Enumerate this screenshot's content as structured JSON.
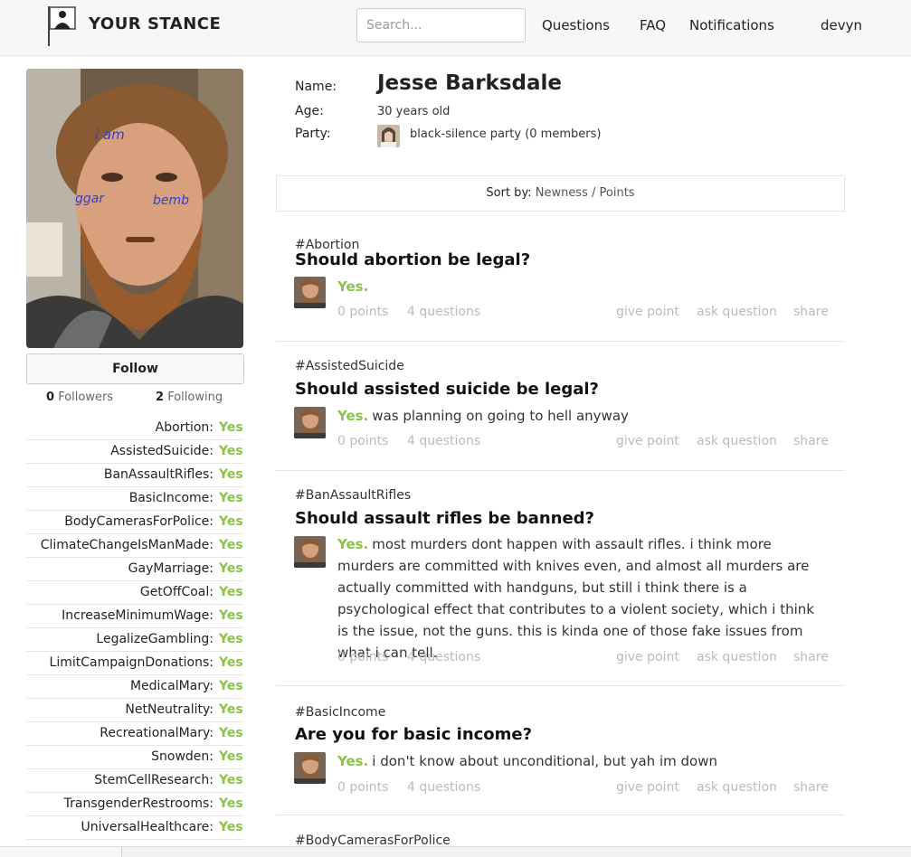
{
  "header": {
    "logo_text": "YOUR STANCE",
    "search_placeholder": "Search...",
    "nav": [
      "Questions",
      "FAQ",
      "Notifications",
      "devyn"
    ]
  },
  "sidebar": {
    "follow_label": "Follow",
    "followers_count": "0",
    "followers_label": "Followers",
    "following_count": "2",
    "following_label": "Following",
    "stances": [
      {
        "topic": "Abortion:",
        "value": "Yes"
      },
      {
        "topic": "AssistedSuicide:",
        "value": "Yes"
      },
      {
        "topic": "BanAssaultRifles:",
        "value": "Yes"
      },
      {
        "topic": "BasicIncome:",
        "value": "Yes"
      },
      {
        "topic": "BodyCamerasForPolice:",
        "value": "Yes"
      },
      {
        "topic": "ClimateChangeIsManMade:",
        "value": "Yes"
      },
      {
        "topic": "GayMarriage:",
        "value": "Yes"
      },
      {
        "topic": "GetOffCoal:",
        "value": "Yes"
      },
      {
        "topic": "IncreaseMinimumWage:",
        "value": "Yes"
      },
      {
        "topic": "LegalizeGambling:",
        "value": "Yes"
      },
      {
        "topic": "LimitCampaignDonations:",
        "value": "Yes"
      },
      {
        "topic": "MedicalMary:",
        "value": "Yes"
      },
      {
        "topic": "NetNeutrality:",
        "value": "Yes"
      },
      {
        "topic": "RecreationalMary:",
        "value": "Yes"
      },
      {
        "topic": "Snowden:",
        "value": "Yes"
      },
      {
        "topic": "StemCellResearch:",
        "value": "Yes"
      },
      {
        "topic": "TransgenderRestrooms:",
        "value": "Yes"
      },
      {
        "topic": "UniversalHealthcare:",
        "value": "Yes"
      }
    ]
  },
  "profile": {
    "name_label": "Name:",
    "name": "Jesse Barksdale",
    "age_label": "Age:",
    "age": "30 years old",
    "party_label": "Party:",
    "party": "black-silence party (0 members)",
    "photo_scribbles": [
      "i am",
      "ggar",
      "bemb"
    ]
  },
  "sort": {
    "label": "Sort by:",
    "options": [
      "Newness",
      "Points"
    ],
    "separator": "/"
  },
  "posts": [
    {
      "tag": "#Abortion",
      "question": "Should abortion be legal?",
      "answer": "Yes.",
      "text": "",
      "points": "0 points",
      "questions": "4 questions",
      "actions": [
        "give point",
        "ask question",
        "share"
      ]
    },
    {
      "tag": "#AssistedSuicide",
      "question": "Should assisted suicide be legal?",
      "answer": "Yes.",
      "text": "was planning on going to hell anyway",
      "points": "0 points",
      "questions": "4 questions",
      "actions": [
        "give point",
        "ask question",
        "share"
      ]
    },
    {
      "tag": "#BanAssaultRifles",
      "question": "Should assault rifles be banned?",
      "answer": "Yes.",
      "text": "most murders dont happen with assault rifles. i think more murders are committed with knives even, and almost all murders are actually committed with handguns, but still i think there is a psychological effect that contributes to a violent society, which i think is the issue, not the guns. this is kinda one of those fake issues from what i can tell.",
      "points": "0 points",
      "questions": "4 questions",
      "actions": [
        "give point",
        "ask question",
        "share"
      ]
    },
    {
      "tag": "#BasicIncome",
      "question": "Are you for basic income?",
      "answer": "Yes.",
      "text": "i don't know about unconditional, but yah im down",
      "points": "0 points",
      "questions": "4 questions",
      "actions": [
        "give point",
        "ask question",
        "share"
      ]
    },
    {
      "tag": "#BodyCamerasForPolice"
    }
  ],
  "colors": {
    "accent_yes": "#8bc34a",
    "meta_gray": "#bbbbbb",
    "border": "#e6e6e6"
  }
}
